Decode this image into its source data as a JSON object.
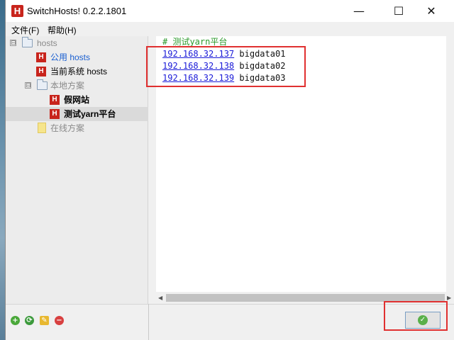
{
  "window": {
    "title": "SwitchHosts! 0.2.2.1801",
    "app_icon_letter": "H",
    "minimize": "—",
    "maximize": "☐",
    "close": "✕"
  },
  "menu": [
    {
      "label": "文件(F)"
    },
    {
      "label": "帮助(H)"
    }
  ],
  "tree": {
    "root": {
      "label": "hosts",
      "expander": "⊟"
    },
    "items": [
      {
        "label": "公用 hosts",
        "icon": "H",
        "color": "#1a5fd0"
      },
      {
        "label": "当前系统 hosts",
        "icon": "H",
        "color": "#000000"
      },
      {
        "label": "本地方案",
        "expander": "⊟",
        "color": "#8a8a8a"
      },
      {
        "label": "假网站",
        "icon": "H",
        "color": "#000000"
      },
      {
        "label": "测试yarn平台",
        "icon": "H",
        "color": "#000000",
        "selected": true
      },
      {
        "label": "在线方案",
        "color": "#8a8a8a"
      }
    ]
  },
  "editor": {
    "comment": "# 测试yarn平台",
    "lines": [
      {
        "ip": "192.168.32.137",
        "host": "bigdata01"
      },
      {
        "ip": "192.168.32.138",
        "host": "bigdata02"
      },
      {
        "ip": "192.168.32.139",
        "host": "bigdata03"
      }
    ]
  },
  "toolbar": {
    "add_icon": "+",
    "refresh_icon": "⟳",
    "edit_icon": "✎",
    "delete_icon": "−",
    "apply_icon": "✓"
  },
  "colors": {
    "hosts_icon": "#c8241c",
    "comment": "#2a9a2a",
    "ip_link": "#1a1ad8",
    "highlight": "#e03030"
  }
}
